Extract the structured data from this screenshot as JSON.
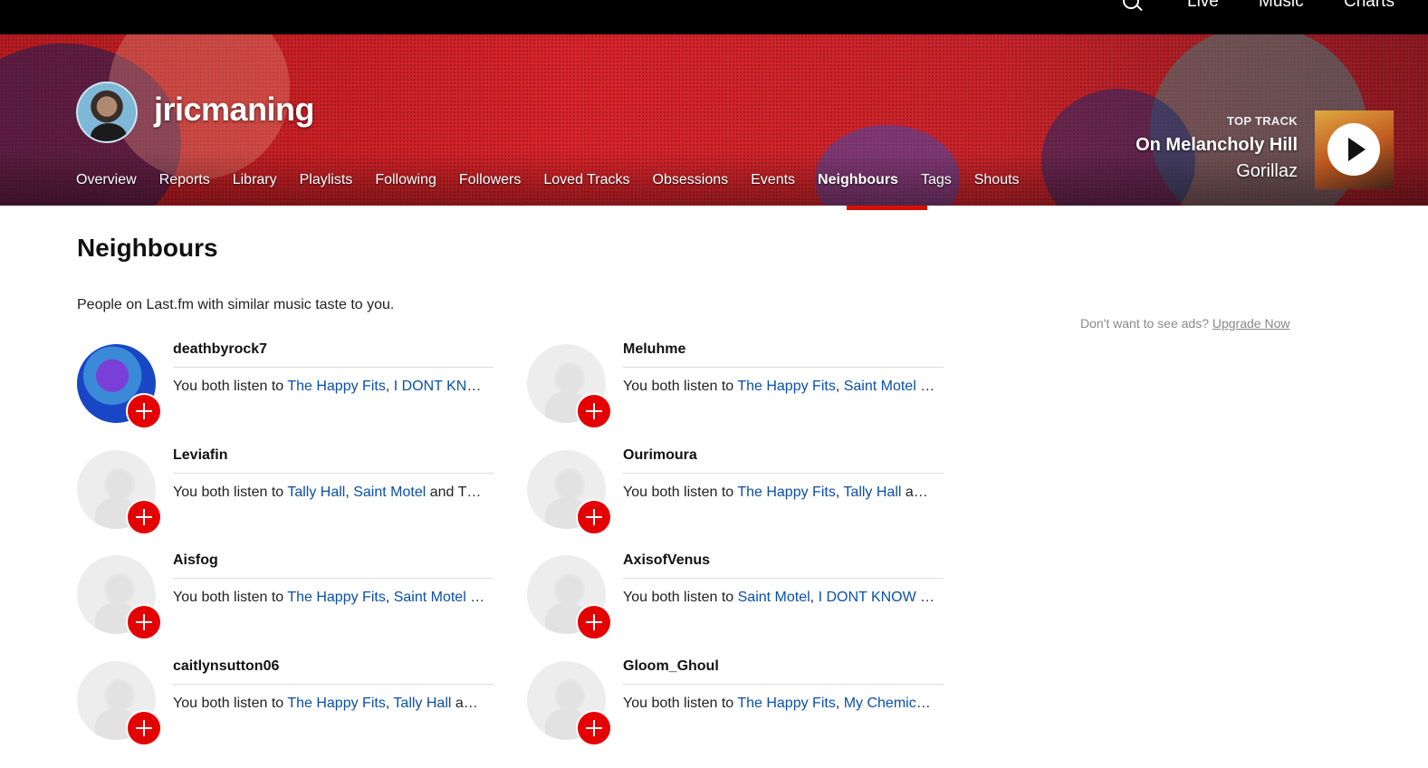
{
  "topnav": {
    "live": "Live",
    "music": "Music",
    "charts": "Charts",
    "search_icon": "search-icon"
  },
  "profile": {
    "username": "jricmaning"
  },
  "tabs": [
    {
      "label": "Overview"
    },
    {
      "label": "Reports"
    },
    {
      "label": "Library"
    },
    {
      "label": "Playlists"
    },
    {
      "label": "Following"
    },
    {
      "label": "Followers"
    },
    {
      "label": "Loved Tracks"
    },
    {
      "label": "Obsessions"
    },
    {
      "label": "Events"
    },
    {
      "label": "Neighbours",
      "active": true
    },
    {
      "label": "Tags"
    },
    {
      "label": "Shouts"
    }
  ],
  "top_track": {
    "label": "TOP TRACK",
    "name": "On Melancholy Hill",
    "artist": "Gorillaz"
  },
  "page": {
    "title": "Neighbours",
    "intro": "People on Last.fm with similar music taste to you."
  },
  "ads": {
    "text": "Don't want to see ads?",
    "link": "Upgrade Now"
  },
  "accent": "#d51007",
  "neighbours": [
    {
      "name": "deathbyrock7",
      "prefix": "You both listen to ",
      "a1": "The Happy Fits",
      "sep": ", ",
      "a2": "I DONT KN",
      "tail": "…"
    },
    {
      "name": "Meluhme",
      "prefix": "You both listen to ",
      "a1": "The Happy Fits",
      "sep": ", ",
      "a2": "Saint Motel",
      "tail": " …"
    },
    {
      "name": "Leviafin",
      "prefix": "You both listen to ",
      "a1": "Tally Hall",
      "sep": ", ",
      "a2": "Saint Motel",
      "tail": " and T…"
    },
    {
      "name": "Ourimoura",
      "prefix": "You both listen to ",
      "a1": "The Happy Fits",
      "sep": ", ",
      "a2": "Tally Hall",
      "tail": " a…"
    },
    {
      "name": "Aisfog",
      "prefix": "You both listen to ",
      "a1": "The Happy Fits",
      "sep": ", ",
      "a2": "Saint Motel",
      "tail": " …"
    },
    {
      "name": "AxisofVenus",
      "prefix": "You both listen to ",
      "a1": "Saint Motel",
      "sep": ", ",
      "a2": "I DONT KNOW",
      "tail": " …"
    },
    {
      "name": "caitlynsutton06",
      "prefix": "You both listen to ",
      "a1": "The Happy Fits",
      "sep": ", ",
      "a2": "Tally Hall",
      "tail": " a…"
    },
    {
      "name": "Gloom_Ghoul",
      "prefix": "You both listen to ",
      "a1": "The Happy Fits",
      "sep": ", ",
      "a2": "My Chemic",
      "tail": "…"
    }
  ]
}
